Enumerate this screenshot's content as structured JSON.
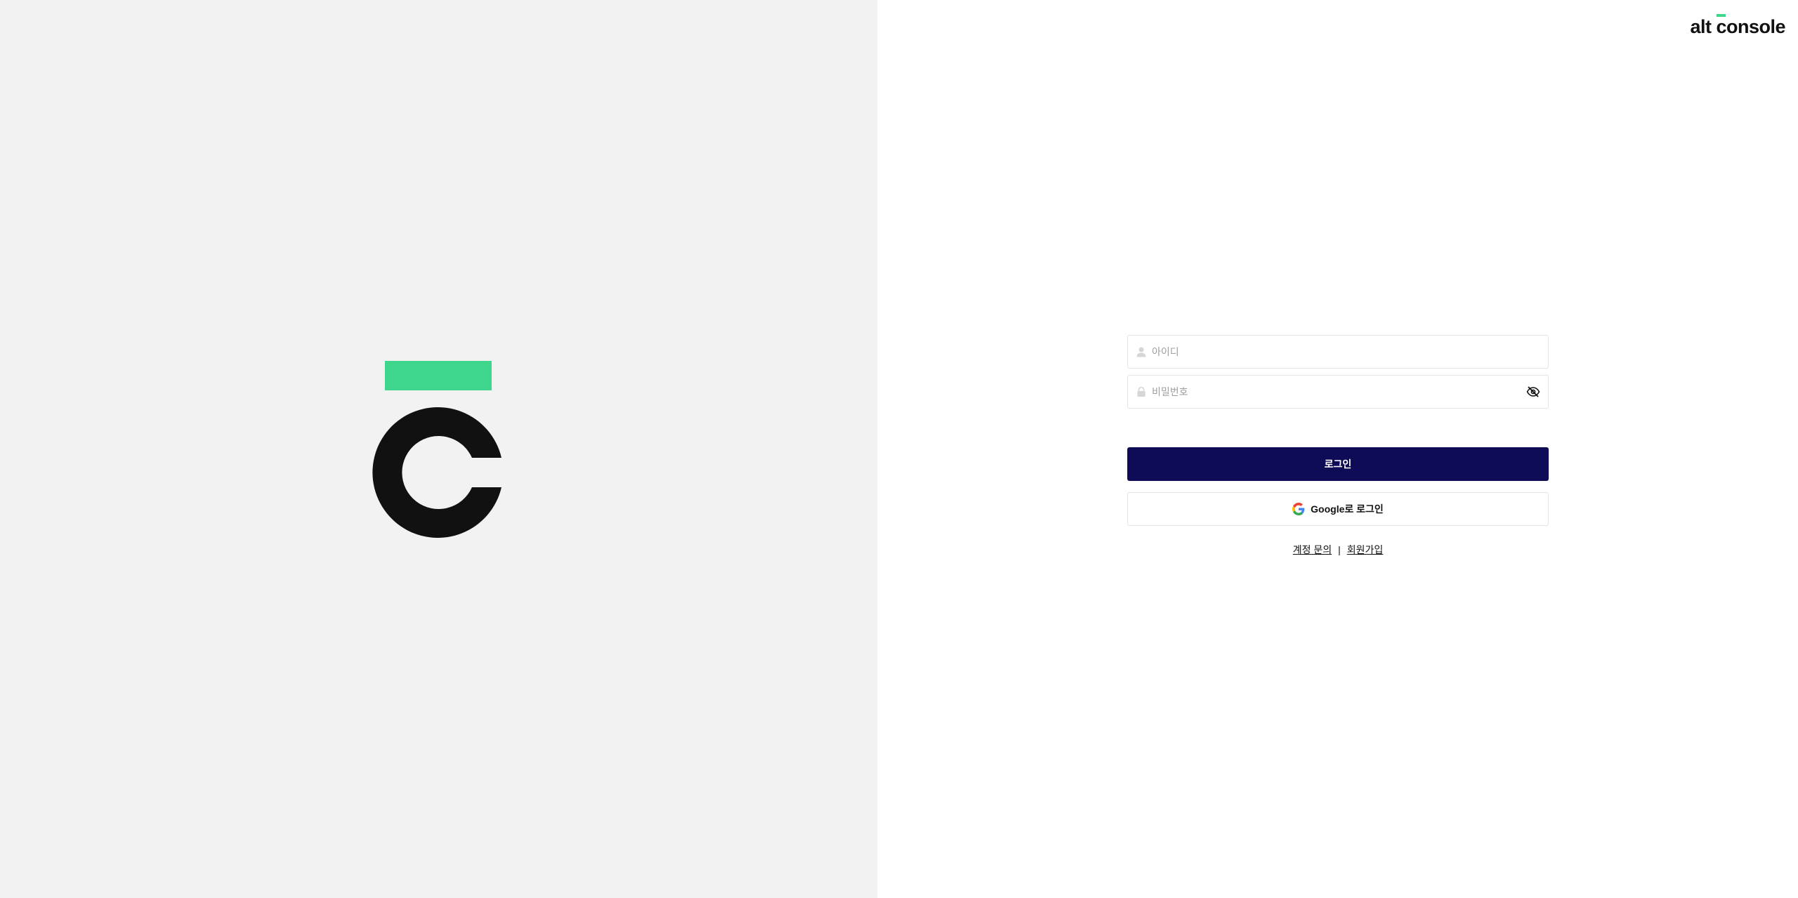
{
  "header": {
    "logo_word_1": "alt",
    "logo_word_2": "console"
  },
  "login": {
    "id_placeholder": "아이디",
    "password_placeholder": "비밀번호",
    "login_button": "로그인",
    "google_button": "Google로 로그인",
    "account_inquiry_link": "계정 문의",
    "separator": "|",
    "signup_link": "회원가입"
  },
  "icons": {
    "user": "user-icon",
    "lock": "lock-icon",
    "eye_off": "eye-off-icon",
    "google": "google-icon"
  },
  "colors": {
    "left_panel_bg": "#f2f2f2",
    "brand_green": "#3dd68c",
    "primary_button": "#0f0c57",
    "brand_black": "#111111"
  }
}
